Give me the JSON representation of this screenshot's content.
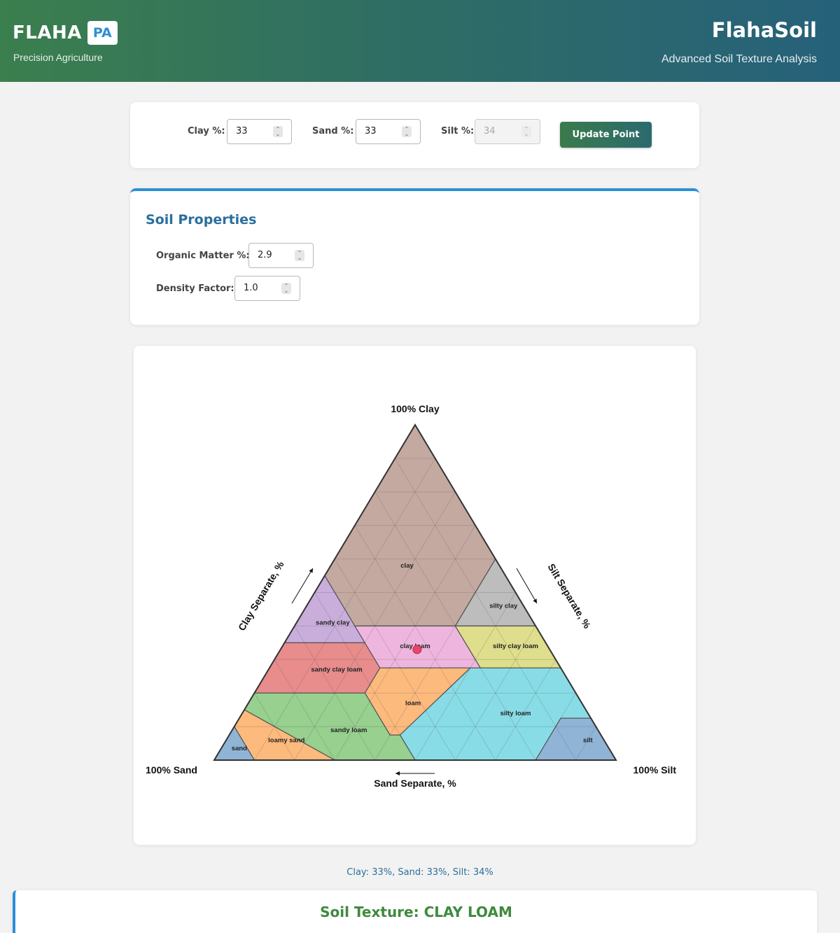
{
  "header": {
    "logo_text": "FLAHA",
    "logo_badge": "PA",
    "tagline": "Precision Agriculture",
    "app_title": "FlahaSoil",
    "app_subtitle": "Advanced Soil Texture Analysis"
  },
  "inputs": {
    "clay_label": "Clay %:",
    "clay_value": "33",
    "sand_label": "Sand %:",
    "sand_value": "33",
    "silt_label": "Silt %:",
    "silt_value": "34",
    "update_button": "Update Point"
  },
  "properties": {
    "title": "Soil Properties",
    "organic_label": "Organic Matter %:",
    "organic_value": "2.9",
    "density_label": "Density Factor:",
    "density_value": "1.0"
  },
  "chart_data": {
    "type": "ternary",
    "title": "",
    "apex_labels": {
      "top": "100% Clay",
      "left": "100% Sand",
      "right": "100% Silt"
    },
    "axis_labels": {
      "clay": "Clay Separate, %",
      "silt": "Silt Separate, %",
      "sand": "Sand Separate, %"
    },
    "grid": true,
    "grid_step": 10,
    "regions": [
      {
        "name": "clay",
        "color": "#c4a9a0",
        "points": [
          [
            0,
            100,
            0
          ],
          [
            0,
            60,
            40
          ],
          [
            20,
            40,
            40
          ],
          [
            45,
            40,
            15
          ],
          [
            45,
            55,
            0
          ]
        ]
      },
      {
        "name": "sandy clay",
        "color": "#c9aedc",
        "points": [
          [
            45,
            55,
            0
          ],
          [
            45,
            35,
            20
          ],
          [
            65,
            35,
            0
          ]
        ]
      },
      {
        "name": "silty clay",
        "color": "#bdbdbd",
        "points": [
          [
            0,
            60,
            40
          ],
          [
            0,
            40,
            60
          ],
          [
            20,
            40,
            40
          ]
        ]
      },
      {
        "name": "sandy clay loam",
        "color": "#e88c8c",
        "points": [
          [
            65,
            35,
            0
          ],
          [
            45,
            35,
            20
          ],
          [
            45,
            27.5,
            27.5
          ],
          [
            52.5,
            20,
            27.5
          ],
          [
            80,
            20,
            0
          ]
        ]
      },
      {
        "name": "clay loam",
        "color": "#eeb6de",
        "points": [
          [
            45,
            40,
            15
          ],
          [
            20,
            40,
            40
          ],
          [
            20,
            27.5,
            52.5
          ],
          [
            45,
            27.5,
            27.5
          ]
        ]
      },
      {
        "name": "silty clay loam",
        "color": "#dede8c",
        "points": [
          [
            20,
            40,
            40
          ],
          [
            0,
            40,
            60
          ],
          [
            0,
            27.5,
            72.5
          ],
          [
            20,
            27.5,
            52.5
          ]
        ]
      },
      {
        "name": "loam",
        "color": "#fdba7d",
        "points": [
          [
            45,
            27.5,
            27.5
          ],
          [
            22.5,
            27.5,
            50
          ],
          [
            50,
            7.5,
            42.5
          ],
          [
            52.5,
            7.5,
            40
          ],
          [
            52.5,
            20,
            27.5
          ]
        ]
      },
      {
        "name": "silty loam",
        "color": "#88dce6",
        "points": [
          [
            22.5,
            27.5,
            50
          ],
          [
            0,
            27.5,
            72.5
          ],
          [
            0,
            12.5,
            87.5
          ],
          [
            7.5,
            12.5,
            80
          ],
          [
            20,
            0,
            80
          ],
          [
            50,
            0,
            50
          ],
          [
            50,
            7.5,
            42.5
          ]
        ]
      },
      {
        "name": "silt",
        "color": "#8fb4d6",
        "points": [
          [
            7.5,
            12.5,
            80
          ],
          [
            0,
            12.5,
            87.5
          ],
          [
            0,
            0,
            100
          ],
          [
            20,
            0,
            80
          ]
        ]
      },
      {
        "name": "sandy loam",
        "color": "#97d08f",
        "points": [
          [
            80,
            20,
            0
          ],
          [
            52.5,
            20,
            27.5
          ],
          [
            52.5,
            7.5,
            40
          ],
          [
            50,
            7.5,
            42.5
          ],
          [
            50,
            0,
            50
          ],
          [
            70,
            0,
            30
          ],
          [
            85,
            15,
            0
          ]
        ]
      },
      {
        "name": "loamy sand",
        "color": "#fdba7d",
        "points": [
          [
            85,
            15,
            0
          ],
          [
            70,
            0,
            30
          ],
          [
            90,
            0,
            10
          ],
          [
            90,
            10,
            0
          ]
        ]
      },
      {
        "name": "sand",
        "color": "#8fb4d6",
        "points": [
          [
            90,
            10,
            0
          ],
          [
            90,
            0,
            10
          ],
          [
            100,
            0,
            0
          ]
        ]
      }
    ],
    "region_labels": [
      {
        "name": "clay",
        "at": [
          23,
          58,
          19
        ]
      },
      {
        "name": "silty clay",
        "at": [
          5,
          46,
          49
        ]
      },
      {
        "name": "sandy clay",
        "at": [
          50,
          41,
          9
        ]
      },
      {
        "name": "clay loam",
        "at": [
          33,
          34,
          33
        ]
      },
      {
        "name": "silty clay loam",
        "at": [
          8,
          34,
          58
        ]
      },
      {
        "name": "sandy clay loam",
        "at": [
          56,
          27,
          17
        ]
      },
      {
        "name": "loam",
        "at": [
          42,
          17,
          41
        ]
      },
      {
        "name": "silty loam",
        "at": [
          18,
          14,
          68
        ]
      },
      {
        "name": "sandy loam",
        "at": [
          62,
          9,
          29
        ]
      },
      {
        "name": "silt",
        "at": [
          4,
          6,
          90
        ]
      },
      {
        "name": "loamy sand",
        "at": [
          79,
          6,
          15
        ]
      },
      {
        "name": "sand",
        "at": [
          92,
          3.5,
          4.5
        ]
      }
    ],
    "point": {
      "clay": 33,
      "sand": 33,
      "silt": 34,
      "color": "#e8456a"
    }
  },
  "readout": "Clay: 33%, Sand: 33%, Silt: 34%",
  "result": "Soil Texture: CLAY LOAM"
}
